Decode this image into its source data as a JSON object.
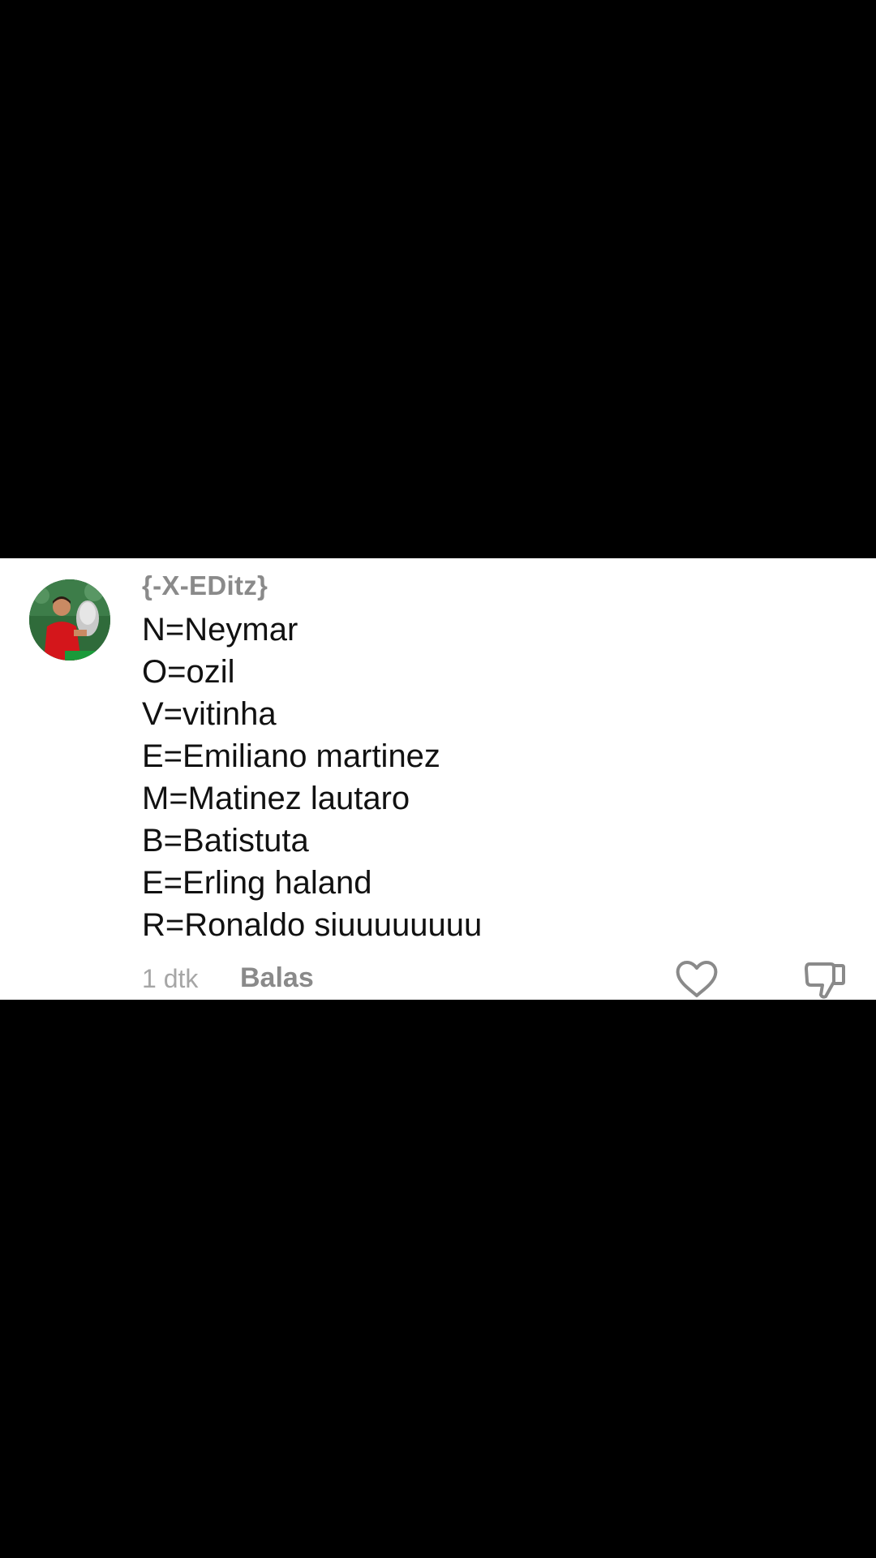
{
  "comment": {
    "username": "{-X-EDitz}",
    "lines": [
      "N=Neymar",
      "O=ozil",
      "V=vitinha",
      "E=Emiliano martinez",
      "M=Matinez lautaro",
      "B=Batistuta",
      "E=Erling haland",
      "R=Ronaldo siuuuuuuuu"
    ],
    "time": "1 dtk",
    "reply_label": "Balas",
    "like_icon": "heart-icon",
    "dislike_icon": "thumbs-down-icon"
  },
  "colors": {
    "background": "#000000",
    "card": "#ffffff",
    "username": "#8a8a8a",
    "text": "#111111",
    "meta": "#a6a6a6"
  }
}
